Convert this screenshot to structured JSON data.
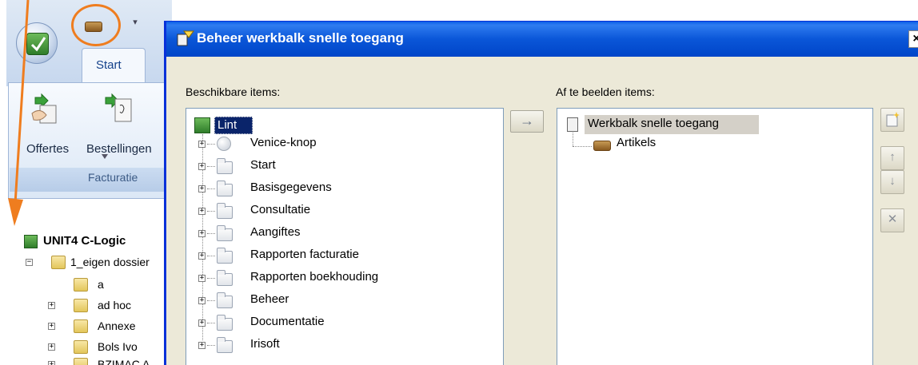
{
  "app": {
    "ribbon": {
      "active_tab": "Start",
      "buttons": [
        {
          "label": "Offertes",
          "icon": "offertes-icon"
        },
        {
          "label": "Bestellingen",
          "icon": "bestellingen-icon"
        }
      ],
      "group_label": "Facturatie"
    },
    "qat_item_icon": "artikels-icon",
    "qat_highlight_color": "#ef7d1f",
    "tree": {
      "root": "UNIT4 C-Logic",
      "items": [
        {
          "label": "1_eigen dossier",
          "expander": "−",
          "level": 0
        },
        {
          "label": "a",
          "expander": "",
          "level": 1
        },
        {
          "label": "ad hoc",
          "expander": "+",
          "level": 1
        },
        {
          "label": "Annexe",
          "expander": "+",
          "level": 1
        },
        {
          "label": "Bols Ivo",
          "expander": "+",
          "level": 1
        },
        {
          "label": "BZIMAC A",
          "expander": "+",
          "level": 1
        }
      ]
    }
  },
  "dialog": {
    "title": "Beheer werkbalk snelle toegang",
    "close_label": "×",
    "available_label": "Beschikbare items:",
    "display_label": "Af te beelden items:",
    "move_button": "→",
    "available_items": {
      "root": "Lint",
      "children": [
        {
          "label": "Venice-knop",
          "icon": "globe-icon"
        },
        {
          "label": "Start",
          "icon": "folder-icon"
        },
        {
          "label": "Basisgegevens",
          "icon": "folder-icon"
        },
        {
          "label": "Consultatie",
          "icon": "folder-icon"
        },
        {
          "label": "Aangiftes",
          "icon": "folder-icon"
        },
        {
          "label": "Rapporten facturatie",
          "icon": "folder-icon"
        },
        {
          "label": "Rapporten boekhouding",
          "icon": "folder-icon"
        },
        {
          "label": "Beheer",
          "icon": "folder-icon"
        },
        {
          "label": "Documentatie",
          "icon": "folder-icon"
        },
        {
          "label": "Irisoft",
          "icon": "folder-icon"
        }
      ]
    },
    "display_items": {
      "root": "Werkbalk snelle toegang",
      "children": [
        {
          "label": "Artikels",
          "icon": "artikels-icon"
        }
      ]
    },
    "side_buttons": [
      {
        "name": "new-item-button",
        "glyph": ""
      },
      {
        "name": "move-up-button",
        "glyph": "↑"
      },
      {
        "name": "move-down-button",
        "glyph": "↓"
      },
      {
        "name": "remove-button",
        "glyph": "✕"
      }
    ],
    "colors": {
      "titlebar": "#0a56d8",
      "face": "#ece9d8",
      "selection": "#0a246a"
    }
  }
}
